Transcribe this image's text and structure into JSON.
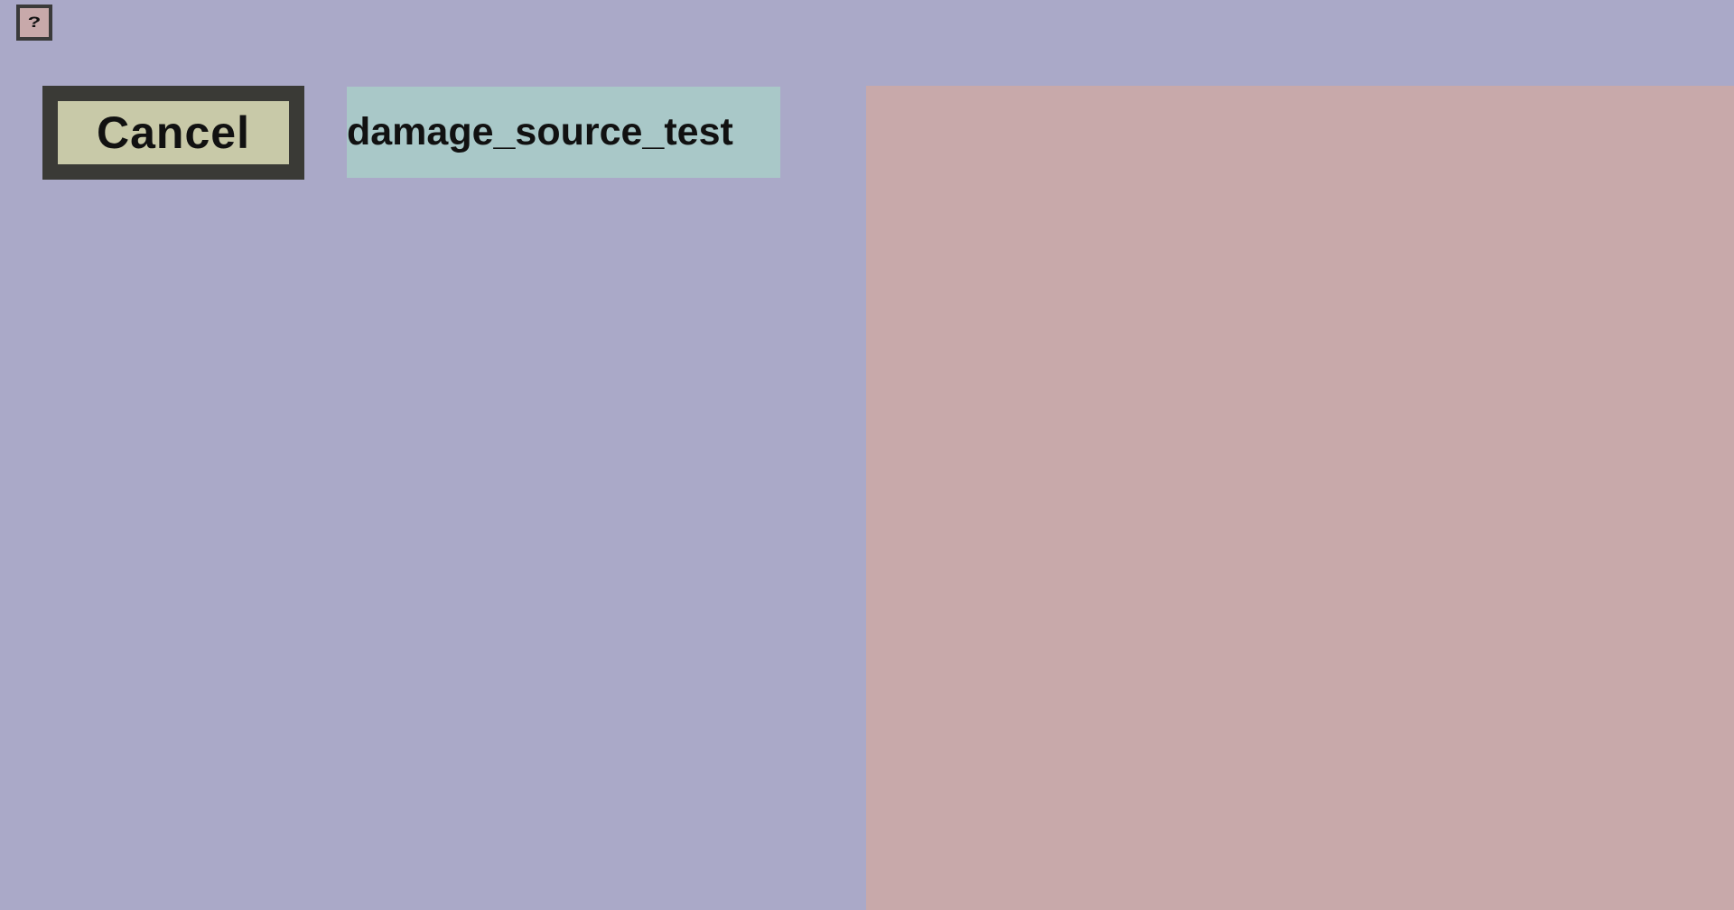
{
  "help": {
    "label": "?"
  },
  "cancel_button": {
    "label": "Cancel"
  },
  "name_field": {
    "value": "damage_source_test"
  },
  "colors": {
    "background": "#aaa9c8",
    "button_face": "#c8c9a8",
    "button_border": "#3a3a36",
    "field_background": "#a9c8c8",
    "panel_background": "#c8a9aa"
  }
}
